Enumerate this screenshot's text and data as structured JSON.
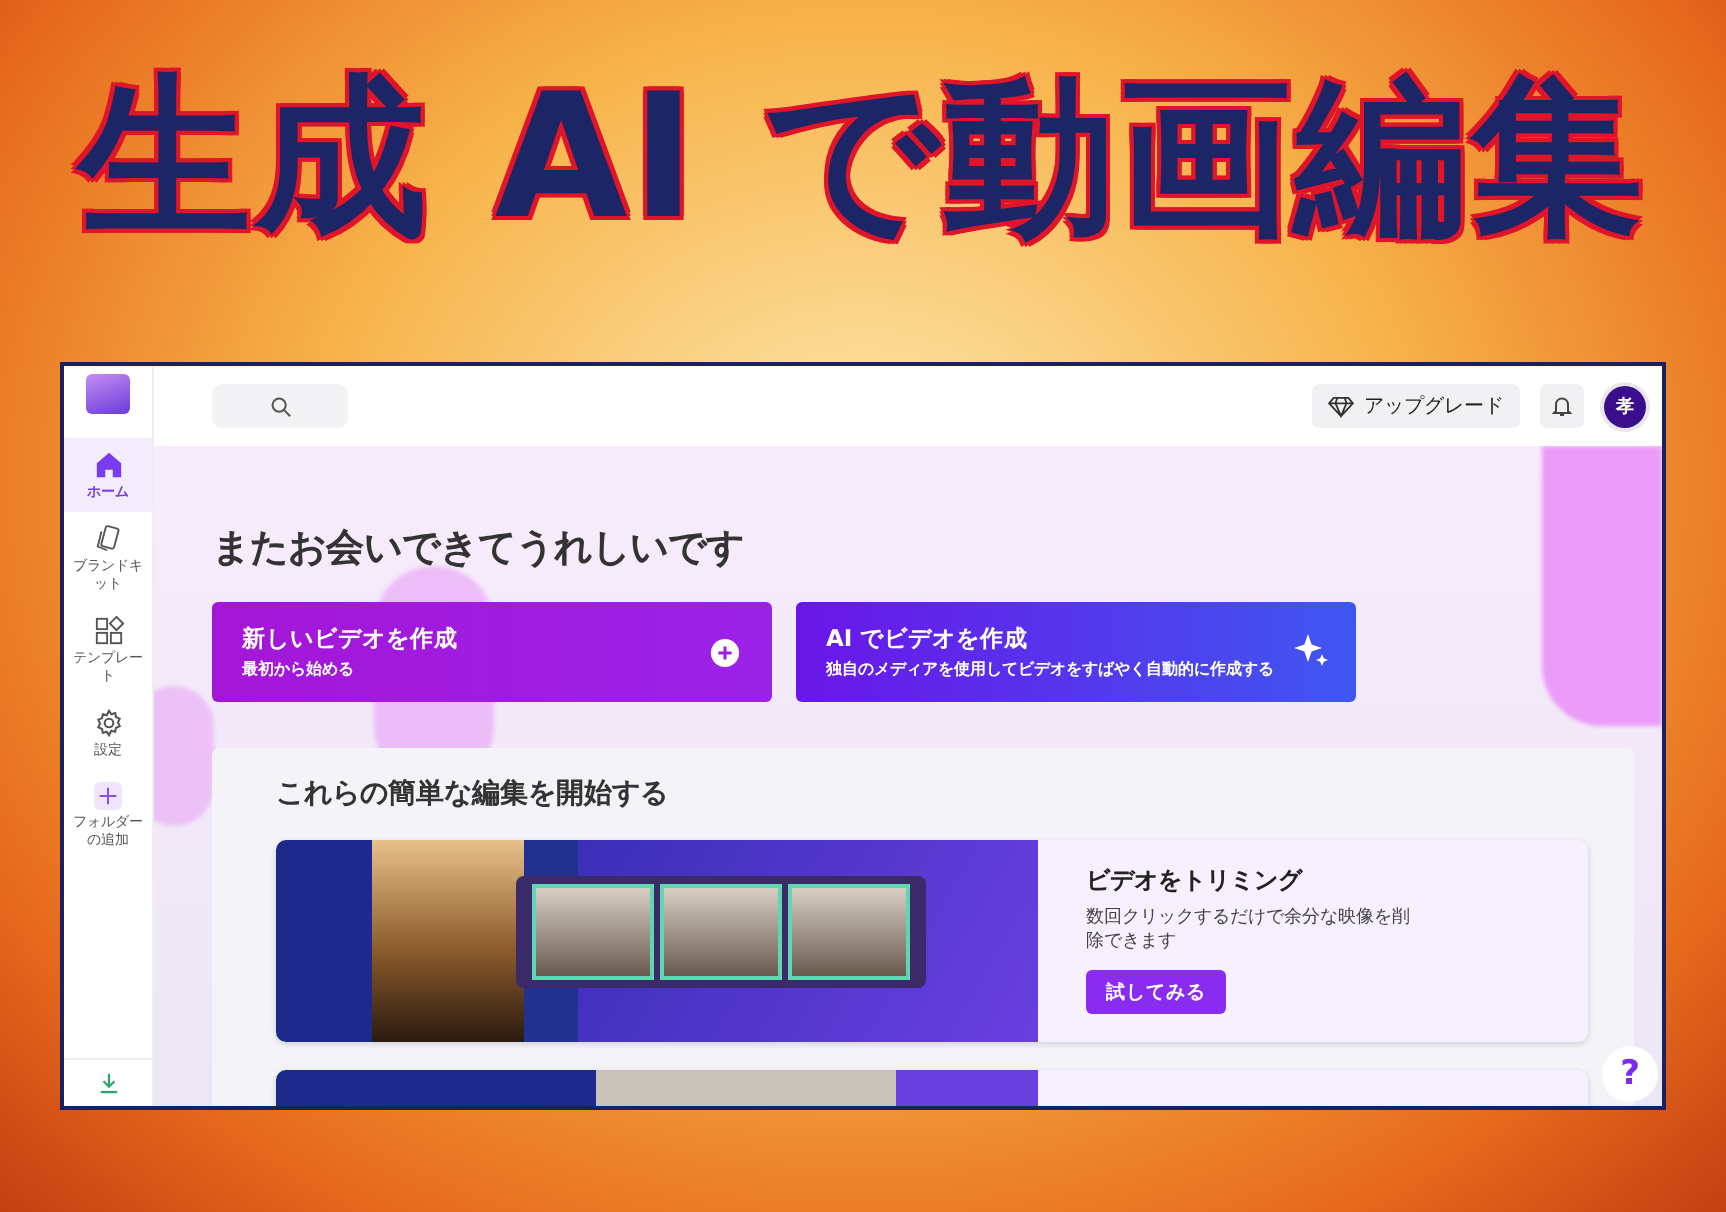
{
  "banner": {
    "title": "生成 AI で動画編集"
  },
  "topbar": {
    "upgrade_label": "アップグレード",
    "avatar_initial": "孝"
  },
  "sidebar": {
    "items": [
      {
        "kind": "home",
        "label": "ホーム",
        "selected": true
      },
      {
        "kind": "brand",
        "label": "ブランドキット",
        "selected": false
      },
      {
        "kind": "template",
        "label": "テンプレート",
        "selected": false
      },
      {
        "kind": "settings",
        "label": "設定",
        "selected": false
      },
      {
        "kind": "add",
        "label": "フォルダーの追加",
        "selected": false
      }
    ]
  },
  "greeting": "またお会いできてうれしいです",
  "actions": [
    {
      "kind": "new",
      "title": "新しいビデオを作成",
      "subtitle": "最初から始める"
    },
    {
      "kind": "ai",
      "title": "AI でビデオを作成",
      "subtitle": "独自のメディアを使用してビデオをすばやく自動的に作成する"
    }
  ],
  "edits": {
    "heading": "これらの簡単な編集を開始する",
    "cards": [
      {
        "title": "ビデオをトリミング",
        "description": "数回クリックするだけで余分な映像を削除できます",
        "button": "試してみる"
      }
    ]
  },
  "help": "?"
}
